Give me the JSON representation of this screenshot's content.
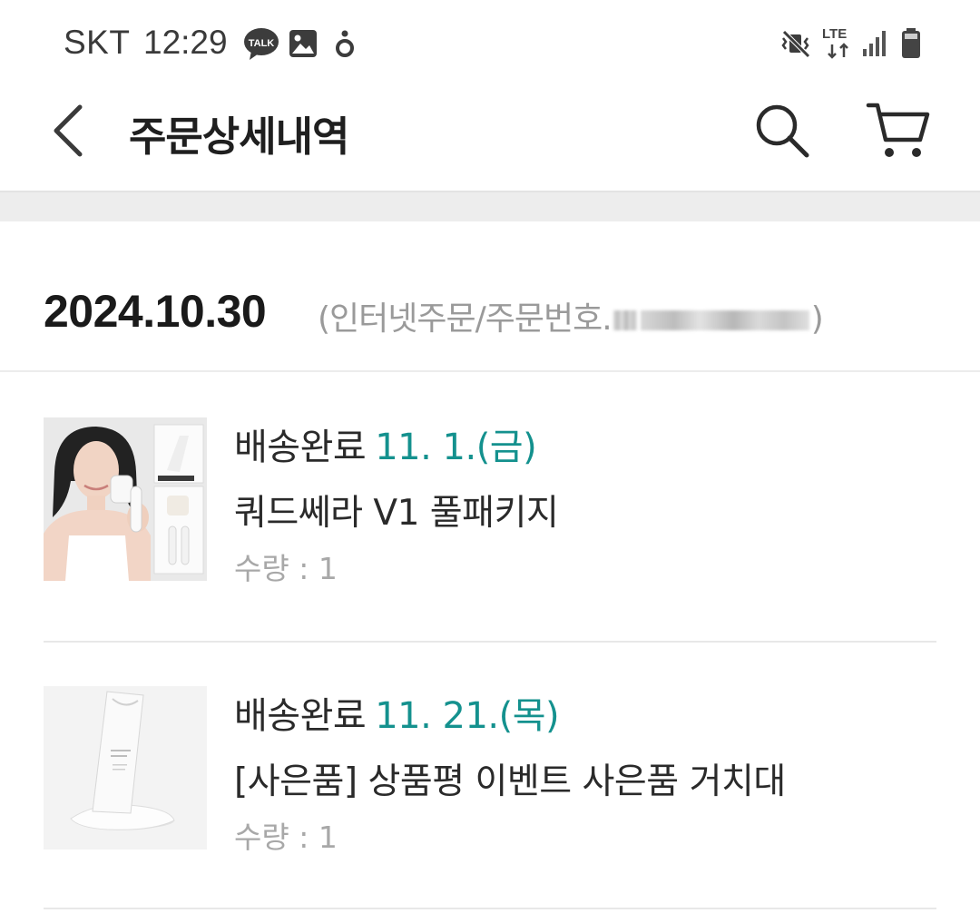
{
  "status_bar": {
    "carrier": "SKT",
    "time": "12:29",
    "talk_badge": "TALK",
    "lte": "LTE"
  },
  "header": {
    "title": "주문상세내역"
  },
  "order": {
    "date": "2024.10.30",
    "meta_prefix": "(인터넷주문/주문번호.",
    "meta_suffix": ")"
  },
  "items": [
    {
      "status": "배송완료",
      "delivery_date": "11. 1.(금)",
      "name": "쿼드쎄라 V1 풀패키지",
      "qty": "수량 : 1"
    },
    {
      "status": "배송완료",
      "delivery_date": "11. 21.(목)",
      "name": "[사은품] 상품평 이벤트 사은품 거치대",
      "qty": "수량 : 1"
    }
  ],
  "colors": {
    "accent": "#14918e",
    "text": "#1f1f1f",
    "muted": "#a8a8a8"
  }
}
